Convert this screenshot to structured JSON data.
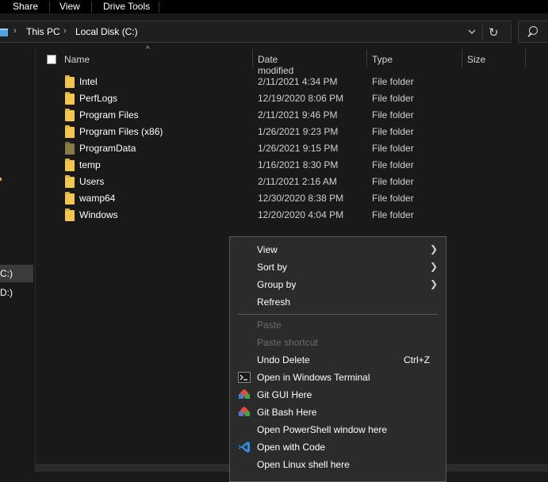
{
  "ribbon": {
    "tabs": [
      {
        "label": "Share"
      },
      {
        "label": "View"
      },
      {
        "label": "Drive Tools"
      }
    ]
  },
  "address": {
    "crumbs": [
      "This PC",
      "Local Disk (C:)"
    ],
    "dropdown_icon": "chevron-down-icon",
    "refresh_icon": "refresh-icon"
  },
  "search": {
    "icon": "search-icon"
  },
  "nav": {
    "items": [
      {
        "label": "C:)",
        "selected": true
      },
      {
        "label": "D:)",
        "selected": false
      }
    ]
  },
  "columns": {
    "name": "Name",
    "date": "Date modified",
    "type": "Type",
    "size": "Size"
  },
  "files": [
    {
      "name": "Intel",
      "date": "2/11/2021 4:34 PM",
      "type": "File folder",
      "hidden": false
    },
    {
      "name": "PerfLogs",
      "date": "12/19/2020 8:06 PM",
      "type": "File folder",
      "hidden": false
    },
    {
      "name": "Program Files",
      "date": "2/11/2021 9:46 PM",
      "type": "File folder",
      "hidden": false
    },
    {
      "name": "Program Files (x86)",
      "date": "1/26/2021 9:23 PM",
      "type": "File folder",
      "hidden": false
    },
    {
      "name": "ProgramData",
      "date": "1/26/2021 9:15 PM",
      "type": "File folder",
      "hidden": true
    },
    {
      "name": "temp",
      "date": "1/16/2021 8:30 PM",
      "type": "File folder",
      "hidden": false
    },
    {
      "name": "Users",
      "date": "2/11/2021 2:16 AM",
      "type": "File folder",
      "hidden": false
    },
    {
      "name": "wamp64",
      "date": "12/30/2020 8:38 PM",
      "type": "File folder",
      "hidden": false
    },
    {
      "name": "Windows",
      "date": "12/20/2020 4:04 PM",
      "type": "File folder",
      "hidden": false
    }
  ],
  "menu": {
    "view": "View",
    "sort_by": "Sort by",
    "group_by": "Group by",
    "refresh": "Refresh",
    "paste": "Paste",
    "paste_shortcut": "Paste shortcut",
    "undo_delete": "Undo Delete",
    "undo_shortcut": "Ctrl+Z",
    "open_terminal": "Open in Windows Terminal",
    "git_gui": "Git GUI Here",
    "git_bash": "Git Bash Here",
    "open_powershell": "Open PowerShell window here",
    "open_code": "Open with Code",
    "open_linux": "Open Linux shell here"
  },
  "colors": {
    "background": "#191919",
    "menu_bg": "#2b2b2b",
    "folder": "#f3c74e",
    "vscode_blue": "#2f8fe6",
    "git_orange": "#e84d31"
  }
}
